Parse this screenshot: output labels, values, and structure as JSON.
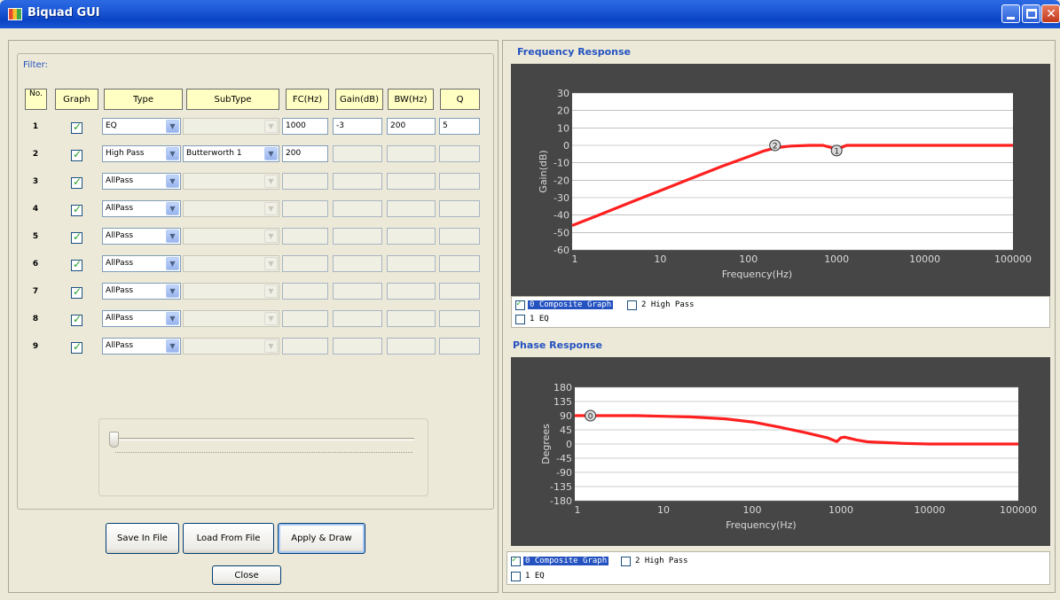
{
  "window": {
    "title": "Biquad GUI"
  },
  "left": {
    "filter_label": "Filter:",
    "headers": [
      "No.",
      "Graph",
      "Type",
      "SubType",
      "FC(Hz)",
      "Gain(dB)",
      "BW(Hz)",
      "Q"
    ],
    "rows": [
      {
        "no": "1",
        "graph": true,
        "type": "EQ",
        "subtype": "",
        "subtype_enabled": false,
        "fc": "1000",
        "gain": "-3",
        "bw": "200",
        "q": "5",
        "fc_on": true,
        "gain_on": true,
        "bw_on": true,
        "q_on": true
      },
      {
        "no": "2",
        "graph": true,
        "type": "High Pass",
        "subtype": "Butterworth 1",
        "subtype_enabled": true,
        "fc": "200",
        "gain": "",
        "bw": "",
        "q": "",
        "fc_on": true,
        "gain_on": false,
        "bw_on": false,
        "q_on": false
      },
      {
        "no": "3",
        "graph": true,
        "type": "AllPass",
        "subtype": "",
        "subtype_enabled": false,
        "fc": "",
        "gain": "",
        "bw": "",
        "q": "",
        "fc_on": false,
        "gain_on": false,
        "bw_on": false,
        "q_on": false
      },
      {
        "no": "4",
        "graph": true,
        "type": "AllPass",
        "subtype": "",
        "subtype_enabled": false,
        "fc": "",
        "gain": "",
        "bw": "",
        "q": "",
        "fc_on": false,
        "gain_on": false,
        "bw_on": false,
        "q_on": false
      },
      {
        "no": "5",
        "graph": true,
        "type": "AllPass",
        "subtype": "",
        "subtype_enabled": false,
        "fc": "",
        "gain": "",
        "bw": "",
        "q": "",
        "fc_on": false,
        "gain_on": false,
        "bw_on": false,
        "q_on": false
      },
      {
        "no": "6",
        "graph": true,
        "type": "AllPass",
        "subtype": "",
        "subtype_enabled": false,
        "fc": "",
        "gain": "",
        "bw": "",
        "q": "",
        "fc_on": false,
        "gain_on": false,
        "bw_on": false,
        "q_on": false
      },
      {
        "no": "7",
        "graph": true,
        "type": "AllPass",
        "subtype": "",
        "subtype_enabled": false,
        "fc": "",
        "gain": "",
        "bw": "",
        "q": "",
        "fc_on": false,
        "gain_on": false,
        "bw_on": false,
        "q_on": false
      },
      {
        "no": "8",
        "graph": true,
        "type": "AllPass",
        "subtype": "",
        "subtype_enabled": false,
        "fc": "",
        "gain": "",
        "bw": "",
        "q": "",
        "fc_on": false,
        "gain_on": false,
        "bw_on": false,
        "q_on": false
      },
      {
        "no": "9",
        "graph": true,
        "type": "AllPass",
        "subtype": "",
        "subtype_enabled": false,
        "fc": "",
        "gain": "",
        "bw": "",
        "q": "",
        "fc_on": false,
        "gain_on": false,
        "bw_on": false,
        "q_on": false
      }
    ],
    "slider_value": 0,
    "buttons": {
      "save": "Save In File",
      "load": "Load From File",
      "apply": "Apply & Draw",
      "close": "Close"
    }
  },
  "right": {
    "freq_title": "Frequency Response",
    "phase_title": "Phase Response",
    "freq_legend": [
      {
        "label": "0  Composite Graph",
        "checked": true,
        "selected": true
      },
      {
        "label": "2  High Pass",
        "checked": false,
        "selected": false
      },
      {
        "label": "1  EQ",
        "checked": false,
        "selected": false
      }
    ],
    "phase_legend": [
      {
        "label": "0  Composite Graph",
        "checked": true,
        "selected": true
      },
      {
        "label": "2  High Pass",
        "checked": false,
        "selected": false
      },
      {
        "label": "1  EQ",
        "checked": false,
        "selected": false
      }
    ]
  },
  "colors": {
    "curve": "#ff2020",
    "plot_bg": "#ffffff",
    "frame_bg": "#464646",
    "accent": "#2452c0",
    "header_bg": "#ffffc4"
  },
  "chart_data": [
    {
      "type": "line",
      "title": "Frequency Response",
      "xlabel": "Frequency(Hz)",
      "ylabel": "Gain(dB)",
      "x_scale": "log",
      "xlim": [
        1,
        100000
      ],
      "ylim": [
        -60,
        30
      ],
      "x_ticks": [
        "1",
        "10",
        "100",
        "1000",
        "10000",
        "100000"
      ],
      "y_ticks": [
        "30",
        "20",
        "10",
        "0",
        "-10",
        "-20",
        "-30",
        "-40",
        "-50",
        "-60"
      ],
      "grid": true,
      "series": [
        {
          "name": "0  Composite Graph",
          "x": [
            1,
            2,
            5,
            10,
            20,
            50,
            100,
            150,
            200,
            300,
            500,
            700,
            900,
            1000,
            1100,
            1300,
            2000,
            5000,
            10000,
            50000,
            100000
          ],
          "y": [
            -46,
            -40,
            -32,
            -26,
            -20,
            -12,
            -6.5,
            -3.2,
            -1.5,
            -0.4,
            0,
            0,
            -1.5,
            -3,
            -1.5,
            0,
            0,
            0,
            0,
            0,
            0
          ]
        }
      ],
      "markers": [
        {
          "label": "2",
          "x": 200,
          "y": 0
        },
        {
          "label": "1",
          "x": 1000,
          "y": -3
        }
      ]
    },
    {
      "type": "line",
      "title": "Phase Response",
      "xlabel": "Frequency(Hz)",
      "ylabel": "Degrees",
      "x_scale": "log",
      "xlim": [
        1,
        100000
      ],
      "ylim": [
        -180,
        180
      ],
      "x_ticks": [
        "1",
        "10",
        "100",
        "1000",
        "10000",
        "100000"
      ],
      "y_ticks": [
        "180",
        "135",
        "90",
        "45",
        "0",
        "-45",
        "-90",
        "-135",
        "-180"
      ],
      "grid": true,
      "series": [
        {
          "name": "0  Composite Graph",
          "x": [
            1,
            5,
            10,
            20,
            50,
            100,
            200,
            400,
            700,
            900,
            1000,
            1100,
            1500,
            2000,
            5000,
            10000,
            100000
          ],
          "y": [
            90,
            90,
            88,
            86,
            80,
            70,
            54,
            36,
            20,
            8,
            20,
            22,
            13,
            7,
            2,
            0,
            0
          ]
        }
      ],
      "markers": [
        {
          "label": "0",
          "x": 1.5,
          "y": 90
        }
      ]
    }
  ]
}
